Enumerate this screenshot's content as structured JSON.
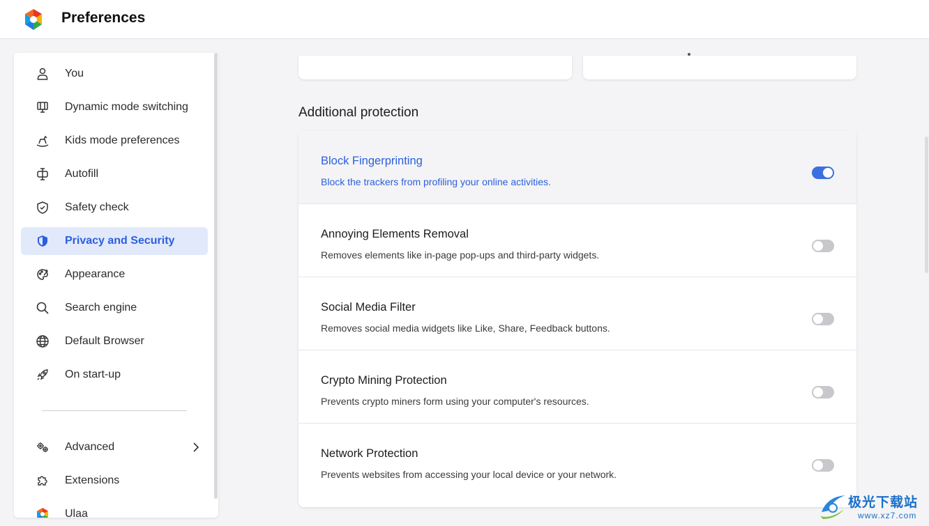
{
  "header": {
    "title": "Preferences"
  },
  "sidebar": {
    "items": [
      {
        "label": "You",
        "icon": "person-icon"
      },
      {
        "label": "Dynamic mode switching",
        "icon": "monitor-icon"
      },
      {
        "label": "Kids mode preferences",
        "icon": "rocking-horse-icon"
      },
      {
        "label": "Autofill",
        "icon": "cursor-text-icon"
      },
      {
        "label": "Safety check",
        "icon": "shield-check-icon"
      },
      {
        "label": "Privacy and Security",
        "icon": "shield-icon",
        "active": true
      },
      {
        "label": "Appearance",
        "icon": "palette-icon"
      },
      {
        "label": "Search engine",
        "icon": "search-icon"
      },
      {
        "label": "Default Browser",
        "icon": "globe-icon"
      },
      {
        "label": "On start-up",
        "icon": "rocket-icon"
      }
    ],
    "secondary": [
      {
        "label": "Advanced",
        "icon": "gears-icon"
      },
      {
        "label": "Extensions",
        "icon": "puzzle-icon"
      },
      {
        "label": "Ulaa",
        "icon": "ulaa-logo-icon"
      }
    ]
  },
  "main": {
    "section_title": "Additional protection",
    "settings": [
      {
        "title": "Block Fingerprinting",
        "description": "Block the trackers from profiling your online activities.",
        "enabled": true
      },
      {
        "title": "Annoying Elements Removal",
        "description": "Removes elements like in-page pop-ups and third-party widgets.",
        "enabled": false
      },
      {
        "title": "Social Media Filter",
        "description": "Removes social media widgets like Like, Share, Feedback buttons.",
        "enabled": false
      },
      {
        "title": "Crypto Mining Protection",
        "description": "Prevents crypto miners form using your computer's resources.",
        "enabled": false
      },
      {
        "title": "Network Protection",
        "description": "Prevents websites from accessing your local device or your network.",
        "enabled": false
      }
    ]
  },
  "watermark": {
    "text": "极光下载站",
    "url": "www.xz7.com"
  },
  "colors": {
    "accent": "#2c5fdc",
    "toggle_on": "#3c6fe0",
    "toggle_off": "#c8c8cc",
    "active_bg": "#e2e9fb"
  }
}
